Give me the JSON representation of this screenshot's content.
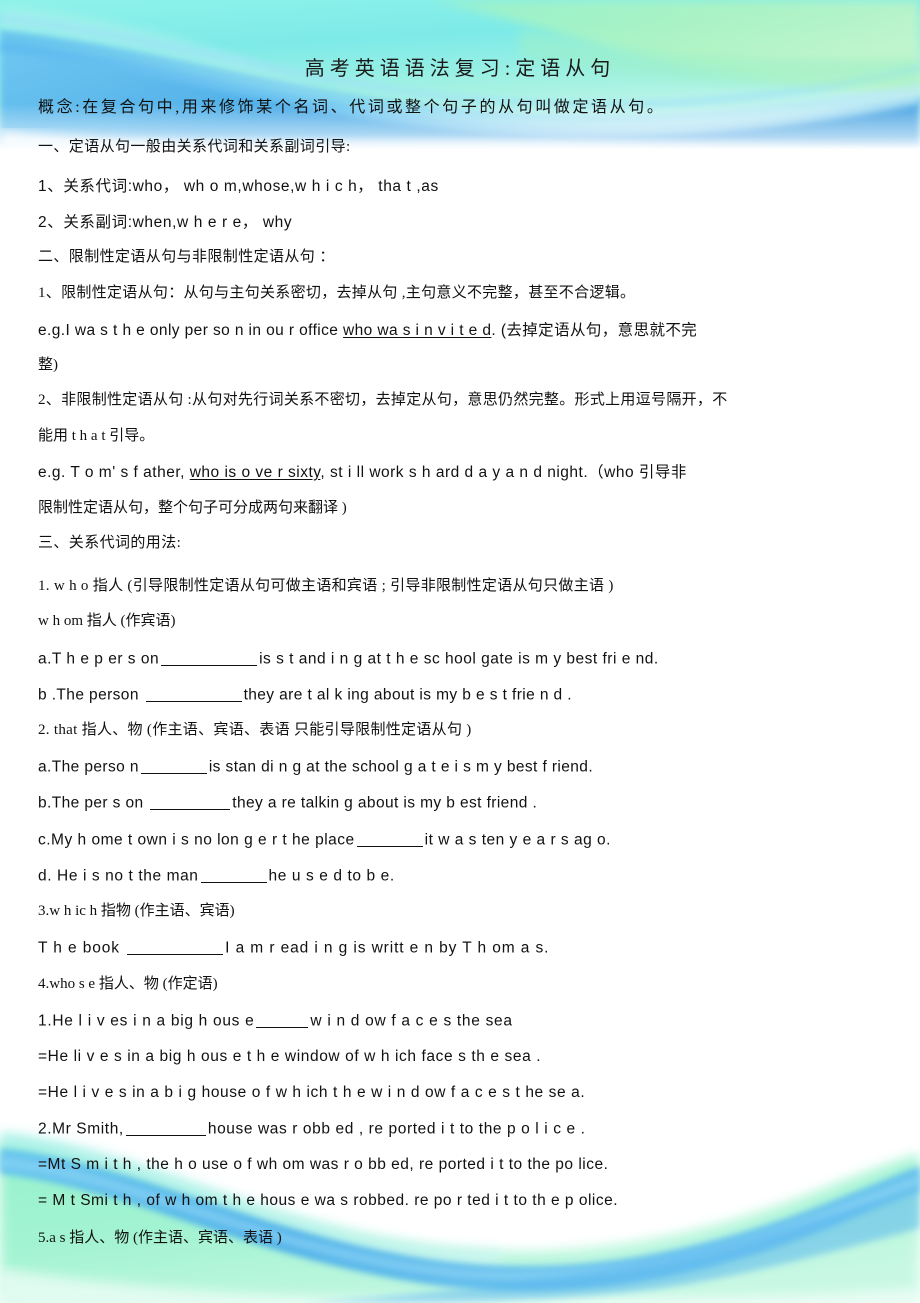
{
  "document": {
    "title": "高考英语语法复习:定语从句",
    "concept": "概念:在复合句中,用来修饰某个名词、代词或整个句子的从句叫做定语从句。"
  },
  "colors": {
    "header_cyan": "#7ef0e6",
    "header_blue": "#4aa8e8",
    "header_green": "#a8f0b8",
    "footer_green": "#8cf0c0",
    "footer_blue": "#45a8ea",
    "text": "#111111"
  },
  "body_lines": [
    {
      "id": "s1-heading",
      "text": "一、定语从句一般由关系代词和关系副词引导:"
    },
    {
      "id": "s1-item1",
      "text": "1、关系代词:who， wh o m,whose,w h i c h， tha t ,as"
    },
    {
      "id": "s1-item2",
      "text": "2、关系副词:when,w h e r e， why"
    },
    {
      "id": "s2-heading",
      "text": "二、限制性定语从句与非限制性定语从句  ："
    },
    {
      "id": "s2-item1",
      "text": "1、限制性定语从句：从句与主句关系密切，去掉从句    ,主句意义不完整，甚至不合逻辑。"
    },
    {
      "id": "s2-eg1-a",
      "text": "e.g.I wa s  t h e only  per so n  in ou r  office "
    },
    {
      "id": "s2-eg1-u",
      "text": "who wa s  i n v i t e d"
    },
    {
      "id": "s2-eg1-b",
      "text": ". (去掉定语从句，意思就不完"
    },
    {
      "id": "s2-eg1-c",
      "text": "整)"
    },
    {
      "id": "s2-item2",
      "text": "2、非限制性定语从句 :从句对先行词关系不密切，去掉定从句，意思仍然完整。形式上用逗号隔开，不"
    },
    {
      "id": "s2-item2b",
      "text": "能用 t h a t 引导。"
    },
    {
      "id": "s2-eg2-a",
      "text": " e.g.  T o m' s  f ather,  "
    },
    {
      "id": "s2-eg2-u",
      "text": "who is   o ve r  sixty"
    },
    {
      "id": "s2-eg2-b",
      "text": ", st i ll   work s   h ard  d a y  a n d night.（who 引导非"
    },
    {
      "id": "s2-eg2-c",
      "text": "限制性定语从句，整个句子可分成两句来翻译   )"
    },
    {
      "id": "s3-heading",
      "text": "三、关系代词的用法:"
    },
    {
      "id": "s3-who",
      "text": "1. w h o     指人   (引导限制性定语从句可做主语和宾语    ;   引导非限制性定语从句只做主语   )"
    },
    {
      "id": "s3-whom",
      "text": "  w h om 指人  (作宾语)"
    },
    {
      "id": "s3-who-a1",
      "text": "a.T h e  p er s on"
    },
    {
      "id": "s3-who-a2",
      "text": "is  s t and i n g  at t h e sc hool gate  is  m y  best  fri e nd."
    },
    {
      "id": "s3-who-b1",
      "text": " b .The person "
    },
    {
      "id": "s3-who-b2",
      "text": "they are   t al k ing about is  my  b e s t  frie n d ."
    },
    {
      "id": "s3-that",
      "text": "2.  that 指人、物    (作主语、宾语、表语   只能引导限制性定语从句 )"
    },
    {
      "id": "s3-that-a1",
      "text": "a.The perso n"
    },
    {
      "id": "s3-that-a2",
      "text": "is stan di n g   at the school g a t e   i s m y  best   f riend."
    },
    {
      "id": "s3-that-b1",
      "text": "b.The per s on "
    },
    {
      "id": "s3-that-b2",
      "text": "they a re talkin g  about  is my  b est friend ."
    },
    {
      "id": "s3-that-c1",
      "text": "c.My   h ome t own  i s no lon g e r   t he place"
    },
    {
      "id": "s3-that-c2",
      "text": "it w a s  ten  y e a r s  ag o."
    },
    {
      "id": "s3-that-d1",
      "text": "d.  He  i s no t  the  man"
    },
    {
      "id": "s3-that-d2",
      "text": "he  u s e d  to b e."
    },
    {
      "id": "s3-which",
      "text": "3.w h ic h  指物    (作主语、宾语)"
    },
    {
      "id": "s3-which-1a",
      "text": "T h e   book  "
    },
    {
      "id": "s3-which-1b",
      "text": "I  a m  r ead i n g  is  writt e n by T h om a s."
    },
    {
      "id": "s3-whose",
      "text": "4.who s e 指人、物        (作定语)"
    },
    {
      "id": "s3-whose-1a",
      "text": "1.He  l i v es i n  a  big  h ous e"
    },
    {
      "id": "s3-whose-1b",
      "text": "w i n d ow  f a c e s  the   sea"
    },
    {
      "id": "s3-whose-2",
      "text": "=He li v e s  in a big  h ous e t h e   window  of  w h ich  face s th e  sea ."
    },
    {
      "id": "s3-whose-3",
      "text": "=He  l i v e s  in a b i g  house o f w h ich  t h e w i n d ow  f a c e s  t he se a."
    },
    {
      "id": "s3-whose-4a",
      "text": "2.Mr   Smith,"
    },
    {
      "id": "s3-whose-4b",
      "text": "house was r obb ed , re ported  i t to the p o l i c e ."
    },
    {
      "id": "s3-whose-5",
      "text": "=Mt  S m i t h , the   h o use o f wh om  was   r o bb ed, re ported  i t   to  the po lice."
    },
    {
      "id": "s3-whose-6",
      "text": "=  M t  Smi t h , of   w h om  t h e  hous e  wa s robbed.  re po r ted  i t to th e  p olice."
    },
    {
      "id": "s3-as",
      "text": "5.a s   指人、物     (作主语、宾语、表语 )"
    }
  ]
}
